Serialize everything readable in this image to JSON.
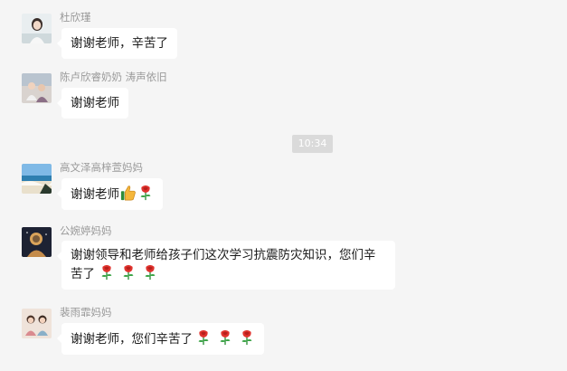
{
  "messages": [
    {
      "sender": "杜欣瑾",
      "text": "谢谢老师，辛苦了",
      "emojis": []
    },
    {
      "sender": "陈卢欣睿奶奶 涛声依旧",
      "text": "谢谢老师",
      "emojis": []
    },
    {
      "sender": "高文泽高梓萱妈妈",
      "text": "谢谢老师",
      "emojis": [
        "thumbs-up-icon",
        "rose-icon"
      ]
    },
    {
      "sender": "公婉婷妈妈",
      "text_line1": "谢谢领导和老师给孩子们这次学习抗震防灾知识，您们辛",
      "text_line2": "苦了",
      "emojis": [
        "rose-icon",
        "rose-icon",
        "rose-icon"
      ]
    },
    {
      "sender": "裴雨霏妈妈",
      "text": "谢谢老师，您们辛苦了",
      "emojis": [
        "rose-icon",
        "rose-icon",
        "rose-icon"
      ]
    }
  ],
  "timestamp": "10:34",
  "colors": {
    "background": "#f5f5f5",
    "bubble": "#ffffff",
    "sender_name": "#9a9a9a",
    "time_badge": "#dadada"
  }
}
